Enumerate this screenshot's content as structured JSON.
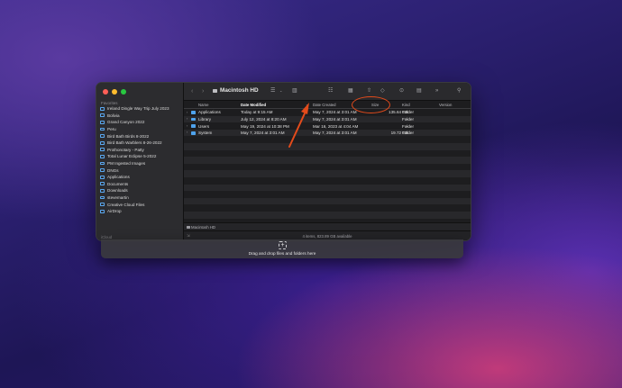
{
  "sidebar": {
    "traffic_lights": [
      "#ff5f57",
      "#febc2e",
      "#28c840"
    ],
    "section_label": "Favorites",
    "items": [
      "Ireland Dingle Way Trip July 2023",
      "Bolivia",
      "Grand Canyon 2022",
      "Peru",
      "Bird Bath Birds 8-2022",
      "Bird Bath Warblers 8-26-2022",
      "Prothonotary - Patty",
      "Total Lunar Eclipse 5-2022",
      "PM Ingested Images",
      "DNGs",
      "Applications",
      "Documents",
      "Downloads",
      "stevemartin",
      "Creative Cloud Files",
      "AirDrop"
    ],
    "footer_label": "iCloud"
  },
  "toolbar": {
    "back": "‹",
    "forward": "›",
    "title": "Macintosh HD",
    "icons": [
      "view-list-icon",
      "group-icon",
      "list-view-icon",
      "gallery-icon",
      "share-icon",
      "tag-icon",
      "more-icon",
      "preview-icon",
      "expand-icon",
      "search-icon"
    ]
  },
  "columns": {
    "name": "Name",
    "date_modified": "Date Modified",
    "date_created": "Date Created",
    "size": "Size",
    "kind": "Kind",
    "version": "Version"
  },
  "files": [
    {
      "name": "Applications",
      "modified": "Today at 9:15 AM",
      "created": "May 7, 2024 at 3:01 AM",
      "size": "135.64 GB",
      "kind": "Folder"
    },
    {
      "name": "Library",
      "modified": "July 12, 2024 at 8:20 AM",
      "created": "May 7, 2024 at 3:01 AM",
      "size": "--",
      "kind": "Folder"
    },
    {
      "name": "Users",
      "modified": "May 19, 2024 at 10:38 PM",
      "created": "Mar 16, 2023 at 4:04 AM",
      "size": "--",
      "kind": "Folder"
    },
    {
      "name": "System",
      "modified": "May 7, 2024 at 3:01 AM",
      "created": "May 7, 2024 at 3:01 AM",
      "size": "19.72 GB",
      "kind": "Folder"
    }
  ],
  "pathbar": {
    "label": "Macintosh HD"
  },
  "statusbar": {
    "text": "4 items, 823.89 GB available"
  },
  "dropzone": {
    "plus": "+",
    "text": "Drag and drop files and folders here"
  },
  "annotation_color": "#e34b1b"
}
